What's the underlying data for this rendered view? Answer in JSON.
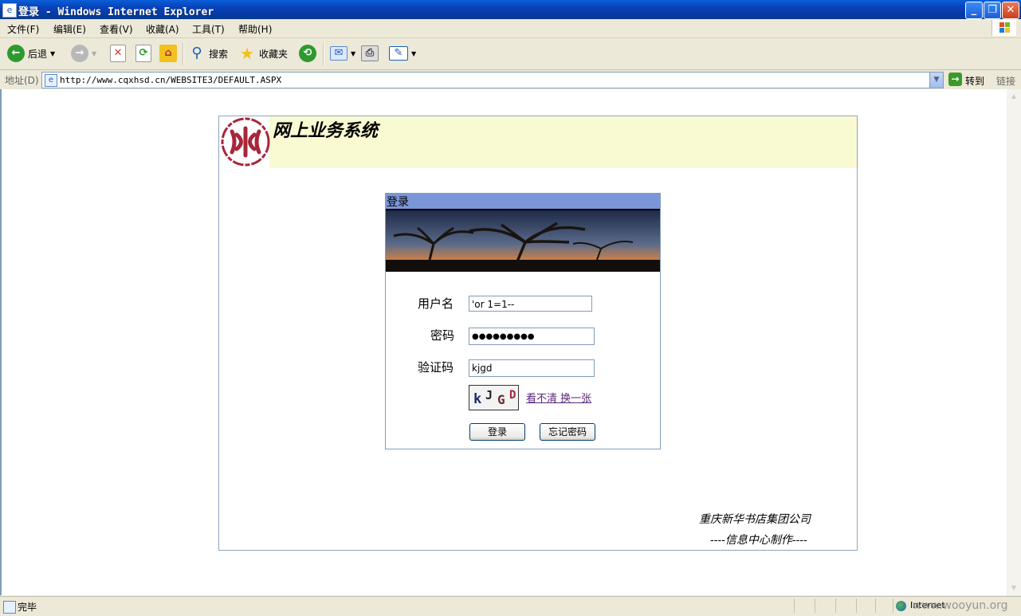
{
  "window": {
    "title": "登录 - Windows Internet Explorer",
    "minimize": "_",
    "restore": "❐",
    "close": "✕"
  },
  "menu": [
    "文件(F)",
    "编辑(E)",
    "查看(V)",
    "收藏(A)",
    "工具(T)",
    "帮助(H)"
  ],
  "toolbar": {
    "back_label": "后退",
    "search_label": "搜索",
    "favorites_label": "收藏夹"
  },
  "address": {
    "label": "地址(D)",
    "url": "http://www.cqxhsd.cn/WEBSITE3/DEFAULT.ASPX",
    "go_label": "转到",
    "links_label": "链接"
  },
  "page": {
    "system_title": "网上业务系统",
    "login_header": "登录",
    "username_label": "用户名",
    "username_value": "'or 1=1--",
    "password_label": "密码",
    "password_value": "●●●●●●●●●",
    "captcha_label": "验证码",
    "captcha_value": "kjgd",
    "captcha_chars": [
      "k",
      "J",
      "G",
      "D"
    ],
    "captcha_refresh_text": "看不清  换一张",
    "login_button": "登录",
    "forgot_button": "忘记密码",
    "footer_line1": "重庆新华书店集团公司",
    "footer_line2": "----信息中心制作----"
  },
  "status": {
    "text": "完毕",
    "zone": "Internet"
  },
  "watermark": "www.wooyun.org",
  "colors": {
    "titlebar": "#0a5fd8",
    "header_band": "#fafad2",
    "login_header": "#7b96d8",
    "logo_red": "#a8263a"
  }
}
